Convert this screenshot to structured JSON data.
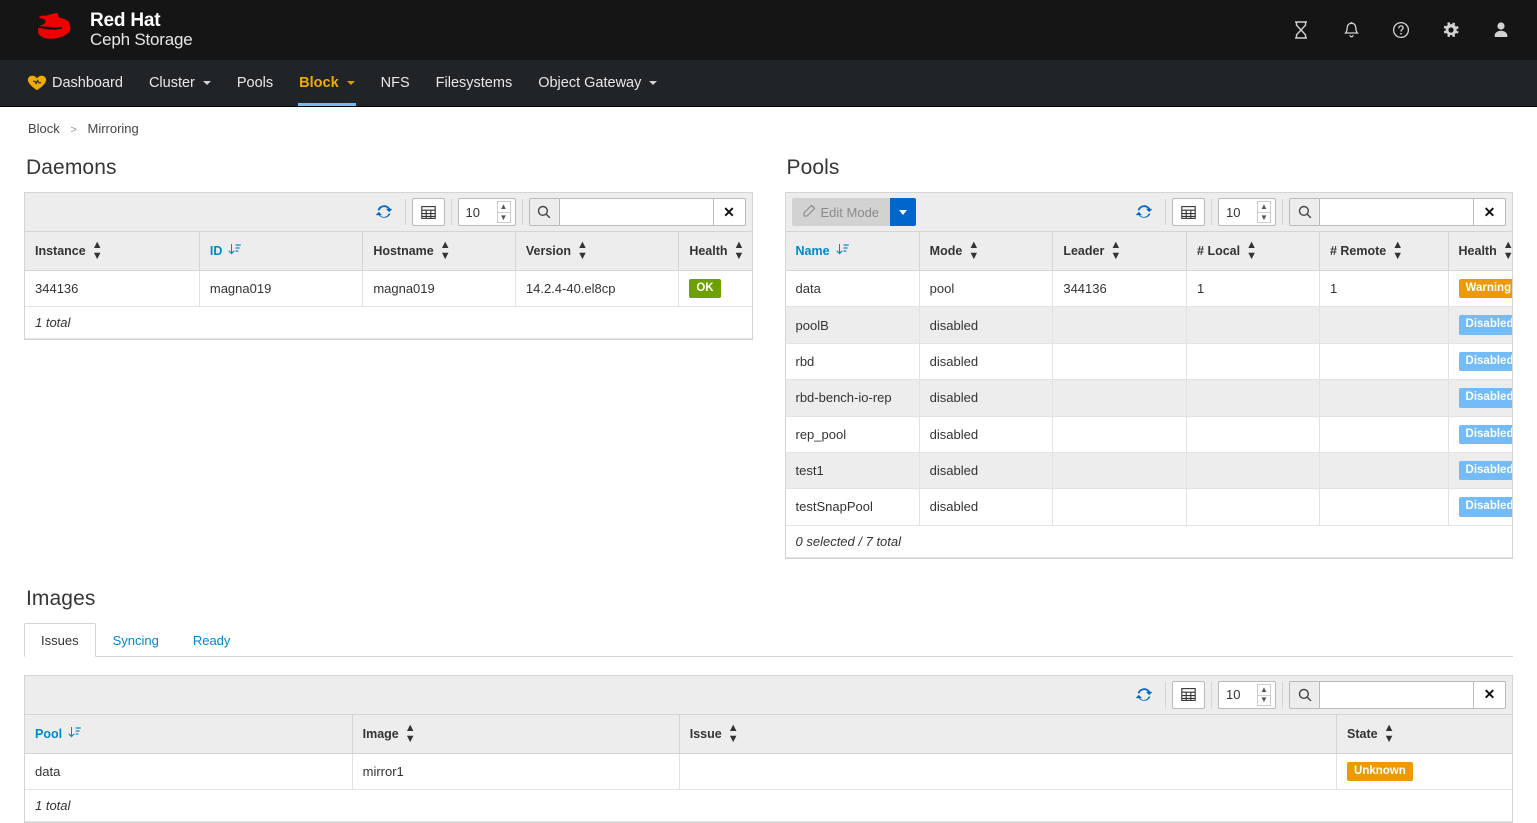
{
  "topbar": {
    "brand_line1": "Red Hat",
    "brand_line2": "Ceph Storage",
    "icons": [
      {
        "name": "tasks-hourglass-icon",
        "label": "Tasks"
      },
      {
        "name": "notifications-bell-icon",
        "label": "Notifications"
      },
      {
        "name": "help-icon",
        "label": "Help"
      },
      {
        "name": "gear-icon",
        "label": "Settings"
      },
      {
        "name": "user-icon",
        "label": "User"
      }
    ]
  },
  "nav": {
    "items": [
      {
        "label": "Dashboard",
        "caret": false,
        "active": false
      },
      {
        "label": "Cluster",
        "caret": true,
        "active": false
      },
      {
        "label": "Pools",
        "caret": false,
        "active": false
      },
      {
        "label": "Block",
        "caret": true,
        "active": true
      },
      {
        "label": "NFS",
        "caret": false,
        "active": false
      },
      {
        "label": "Filesystems",
        "caret": false,
        "active": false
      },
      {
        "label": "Object Gateway",
        "caret": true,
        "active": false
      }
    ]
  },
  "breadcrumb": {
    "root": "Block",
    "separator": ">",
    "current": "Mirroring"
  },
  "daemons": {
    "title": "Daemons",
    "toolbar": {
      "page_size": "10",
      "search_value": "",
      "search_placeholder": ""
    },
    "columns": [
      {
        "label": "Instance",
        "sorted": false
      },
      {
        "label": "ID",
        "sorted": true
      },
      {
        "label": "Hostname",
        "sorted": false
      },
      {
        "label": "Version",
        "sorted": false
      },
      {
        "label": "Health",
        "sorted": false
      }
    ],
    "rows": [
      {
        "instance": "344136",
        "id": "magna019",
        "hostname": "magna019",
        "version": "14.2.4-40.el8cp",
        "health": "OK",
        "health_style": "ok"
      }
    ],
    "footer": "1 total"
  },
  "pools": {
    "title": "Pools",
    "toolbar": {
      "edit_mode_label": "Edit Mode",
      "page_size": "10",
      "search_value": "",
      "search_placeholder": ""
    },
    "columns": [
      {
        "label": "Name",
        "sorted": true
      },
      {
        "label": "Mode",
        "sorted": false
      },
      {
        "label": "Leader",
        "sorted": false
      },
      {
        "label": "# Local",
        "sorted": false
      },
      {
        "label": "# Remote",
        "sorted": false
      },
      {
        "label": "Health",
        "sorted": false
      }
    ],
    "rows": [
      {
        "name": "data",
        "mode": "pool",
        "leader": "344136",
        "local": "1",
        "remote": "1",
        "health": "Warning",
        "health_style": "warning"
      },
      {
        "name": "poolB",
        "mode": "disabled",
        "leader": "",
        "local": "",
        "remote": "",
        "health": "Disabled",
        "health_style": "disabled"
      },
      {
        "name": "rbd",
        "mode": "disabled",
        "leader": "",
        "local": "",
        "remote": "",
        "health": "Disabled",
        "health_style": "disabled"
      },
      {
        "name": "rbd-bench-io-rep",
        "mode": "disabled",
        "leader": "",
        "local": "",
        "remote": "",
        "health": "Disabled",
        "health_style": "disabled"
      },
      {
        "name": "rep_pool",
        "mode": "disabled",
        "leader": "",
        "local": "",
        "remote": "",
        "health": "Disabled",
        "health_style": "disabled"
      },
      {
        "name": "test1",
        "mode": "disabled",
        "leader": "",
        "local": "",
        "remote": "",
        "health": "Disabled",
        "health_style": "disabled"
      },
      {
        "name": "testSnapPool",
        "mode": "disabled",
        "leader": "",
        "local": "",
        "remote": "",
        "health": "Disabled",
        "health_style": "disabled"
      }
    ],
    "footer": "0 selected / 7 total"
  },
  "images": {
    "title": "Images",
    "tabs": [
      {
        "label": "Issues",
        "active": true
      },
      {
        "label": "Syncing",
        "active": false
      },
      {
        "label": "Ready",
        "active": false
      }
    ],
    "toolbar": {
      "page_size": "10",
      "search_value": "",
      "search_placeholder": ""
    },
    "columns": [
      {
        "label": "Pool",
        "sorted": true
      },
      {
        "label": "Image",
        "sorted": false
      },
      {
        "label": "Issue",
        "sorted": false
      },
      {
        "label": "State",
        "sorted": false
      }
    ],
    "rows": [
      {
        "pool": "data",
        "image": "mirror1",
        "issue": "",
        "state": "Unknown",
        "state_style": "unknown"
      }
    ],
    "footer": "1 total"
  },
  "colors": {
    "accent_orange": "#f0ab00",
    "accent_blue": "#0088ce",
    "link_blue": "#0066cc",
    "badge_ok": "#6ca100",
    "badge_warning": "#ec9a00",
    "badge_disabled": "#73bcf7",
    "topbar_bg": "#151515",
    "navbar_bg": "#212427"
  }
}
